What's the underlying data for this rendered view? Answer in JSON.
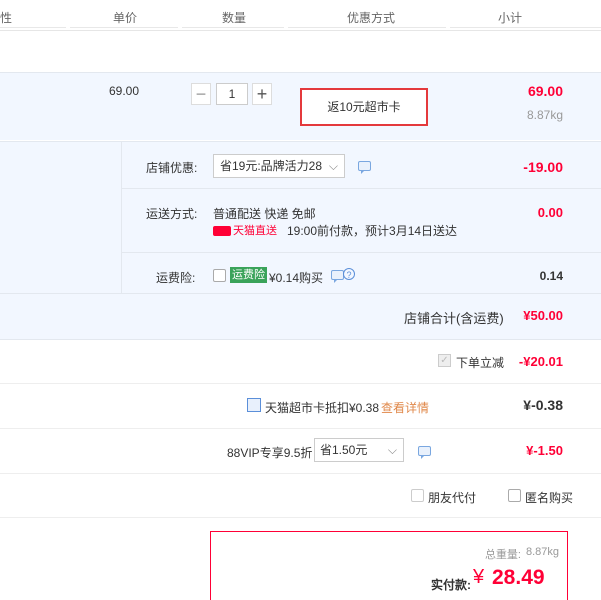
{
  "header": {
    "col_attr": "性",
    "col_price": "单价",
    "col_qty": "数量",
    "col_discount": "优惠方式",
    "col_subtotal": "小计"
  },
  "item": {
    "unit_price": "69.00",
    "quantity": "1",
    "promo": "返10元超市卡",
    "subtotal": "69.00",
    "weight": "8.87kg"
  },
  "shop": {
    "discount_label": "店铺优惠:",
    "discount_select": "省19元:品牌活力28",
    "discount_amount": "-19.00",
    "shipping_label": "运送方式:",
    "shipping_method": "普通配送 快递 免邮",
    "shipping_brand": "天猫直送",
    "shipping_note": "19:00前付款，预计3月14日送达",
    "shipping_amount": "0.00",
    "insurance_label": "运费险:",
    "insurance_badge": "运费险",
    "insurance_text": "¥0.14购买",
    "insurance_amount": "0.14",
    "total_label": "店铺合计(含运费)",
    "total_amount": "¥50.00"
  },
  "order": {
    "instant_discount_label": "下单立减",
    "instant_discount_amount": "-¥20.01",
    "card_label": "天猫超市卡抵扣¥0.38",
    "card_link": "查看详情",
    "card_amount": "¥-0.38",
    "vip_label": "88VIP专享9.5折",
    "vip_select": "省1.50元",
    "vip_amount": "¥-1.50",
    "friend_pay_label": "朋友代付",
    "anonymous_label": "匿名购买",
    "weight_label": "总重量:",
    "weight_value": "8.87kg",
    "pay_label": "实付款:",
    "pay_currency": "¥",
    "pay_amount": "28.49"
  },
  "colors": {
    "red": "#ff0036",
    "blue_bg": "#f2f7ff",
    "highlight_box": "#e4393c"
  }
}
